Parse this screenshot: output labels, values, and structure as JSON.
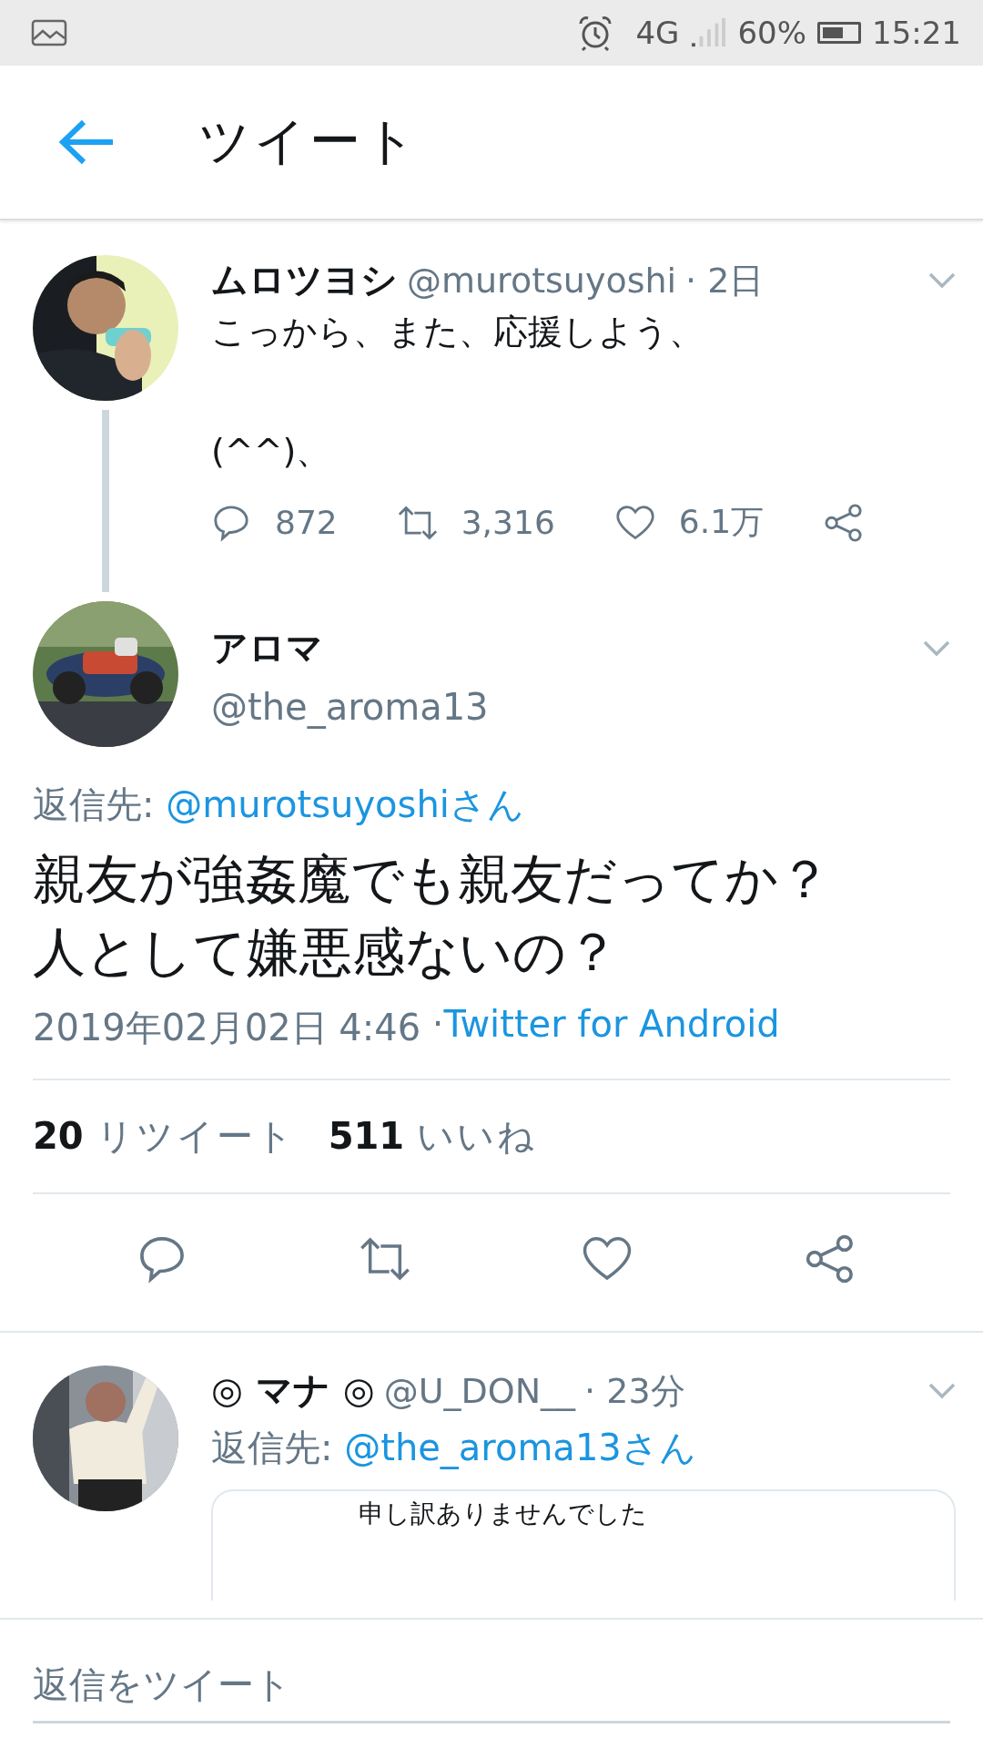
{
  "status_bar": {
    "network": "4G",
    "battery": "60%",
    "time": "15:21"
  },
  "header": {
    "title": "ツイート"
  },
  "parent_tweet": {
    "name": "ムロツヨシ",
    "handle": "@murotsuyoshi",
    "time": "· 2日",
    "lines": [
      "こっから、また、応援しよう、",
      "(^^)、"
    ],
    "actions": [
      {
        "kind": "reply",
        "count": "872"
      },
      {
        "kind": "retweet",
        "count": "3,316"
      },
      {
        "kind": "like",
        "count": "6.1万"
      },
      {
        "kind": "share"
      }
    ]
  },
  "main_tweet": {
    "name": "アロマ",
    "handle": "@the_aroma13",
    "reply_label": "返信先:",
    "reply_to": "@murotsuyoshiさん",
    "text_lines": [
      "親友が強姦魔でも親友だってか？",
      "人として嫌悪感ないの？"
    ],
    "date": "2019年02月02日 4:46",
    "via": "· ",
    "source": "Twitter for Android",
    "stats": [
      {
        "count": "20",
        "label": "リツイート"
      },
      {
        "count": "511",
        "label": "いいね"
      }
    ],
    "actions": [
      {
        "kind": "reply"
      },
      {
        "kind": "retweet"
      },
      {
        "kind": "like"
      },
      {
        "kind": "share"
      }
    ]
  },
  "reply_tweet": {
    "name": "◎ マナ ◎",
    "handle": "@U_DON__",
    "time": "· 23分",
    "reply_label": "返信先:",
    "reply_to": "@the_aroma13さん",
    "card_text": "申し訳ありませんでした"
  },
  "compose": {
    "placeholder": "返信をツイート"
  }
}
